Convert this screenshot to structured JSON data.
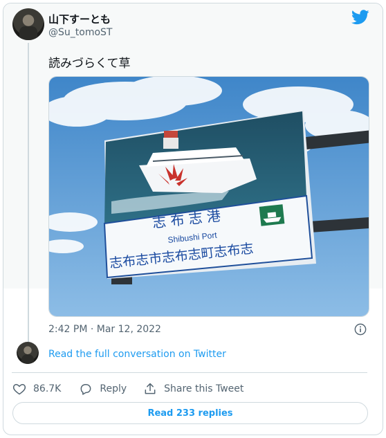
{
  "author": {
    "display_name": "山下すーとも",
    "handle": "@Su_tomoST",
    "avatar_icon": "avatar-portrait"
  },
  "tweet": {
    "text": "読みづらくて草",
    "timestamp": "2:42 PM · Mar 12, 2022"
  },
  "media": {
    "sign": {
      "line1": "志 布 志 港",
      "line2": "Shibushi Port",
      "line3": "志布志市志布志町志布志"
    }
  },
  "footer": {
    "read_conversation": "Read the full conversation on Twitter",
    "likes": "86.7K",
    "reply_label": "Reply",
    "share_label": "Share this Tweet",
    "read_replies": "Read 233 replies"
  },
  "icons": {
    "brand": "twitter-bird-icon",
    "info": "info-icon",
    "like": "heart-icon",
    "reply": "speech-bubble-icon",
    "share": "share-upload-icon"
  },
  "colors": {
    "accent": "#1d9bf0",
    "text": "#0f1419",
    "muted": "#536471",
    "border": "#cfd9de"
  }
}
